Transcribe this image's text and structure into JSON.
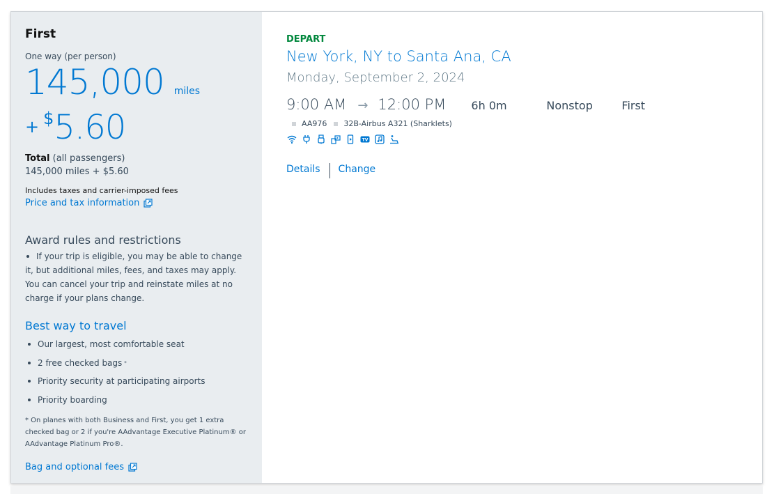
{
  "fare": {
    "cabin_title": "First",
    "price_label": "One way (per person)",
    "miles": "145,000",
    "miles_unit": "miles",
    "plus": "+",
    "currency_symbol": "$",
    "fee": "5.60",
    "total_label": "Total",
    "total_suffix": " (all passengers)",
    "total_value": "145,000 miles + $5.60",
    "includes_text": "Includes taxes and carrier-imposed fees",
    "price_tax_link": "Price and tax information"
  },
  "award_rules": {
    "title": "Award rules and restrictions",
    "body": "If your trip is eligible, you may be able to change it, but additional miles, fees, and taxes may apply. You can cancel your trip and reinstate miles at no charge if your plans change."
  },
  "best_way": {
    "title": "Best way to travel",
    "benefits": [
      "Our largest, most comfortable seat",
      "2 free checked bags",
      "Priority security at participating airports",
      "Priority boarding"
    ],
    "bag_marker": "*",
    "footnote": "* On planes with both Business and First, you get 1 extra checked bag or 2 if you're AAdvantage Executive Platinum® or AAdvantage Platinum Pro®.",
    "bag_fees_link": "Bag and optional fees"
  },
  "flight": {
    "direction_label": "DEPART",
    "route": "New York, NY to Santa Ana, CA",
    "date": "Monday, September 2, 2024",
    "depart_time": "9:00 AM",
    "arrow": "→",
    "arrive_time": "12:00 PM",
    "duration": "6h 0m",
    "stops": "Nonstop",
    "cabin": "First",
    "flight_number": "AA976",
    "aircraft": "32B-Airbus A321 (Sharklets)",
    "amenity_icons": [
      "wifi-icon",
      "power-outlet-icon",
      "usb-icon",
      "on-demand-entertainment-icon",
      "device-entertainment-icon",
      "tv-icon",
      "music-icon",
      "lie-flat-seat-icon"
    ],
    "tv_badge": "TV",
    "details_link": "Details",
    "change_link": "Change"
  },
  "colors": {
    "link_blue": "#0078d2",
    "depart_green": "#00873c",
    "panel_gray": "#e9edf0",
    "text_slate": "#36495a"
  }
}
